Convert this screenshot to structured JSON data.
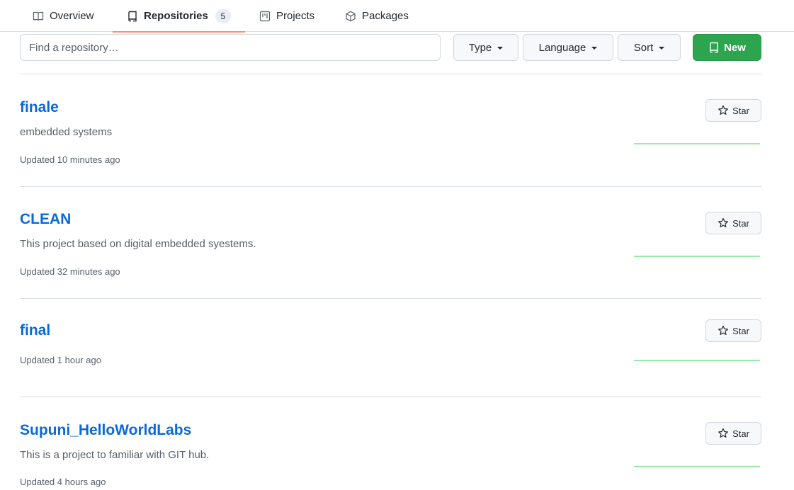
{
  "tabs": [
    {
      "label": "Overview",
      "icon": "book-icon"
    },
    {
      "label": "Repositories",
      "icon": "repo-icon",
      "count": "5"
    },
    {
      "label": "Projects",
      "icon": "project-icon"
    },
    {
      "label": "Packages",
      "icon": "package-icon"
    }
  ],
  "filters": {
    "search_placeholder": "Find a repository…",
    "type_label": "Type",
    "language_label": "Language",
    "sort_label": "Sort",
    "new_label": "New"
  },
  "repos": [
    {
      "name": "finale",
      "description": "embedded systems",
      "updated": "Updated 10 minutes ago",
      "star_label": "Star"
    },
    {
      "name": "CLEAN",
      "description": "This project based on digital embedded syestems.",
      "updated": "Updated 32 minutes ago",
      "star_label": "Star"
    },
    {
      "name": "final",
      "description": "",
      "updated": "Updated 1 hour ago",
      "star_label": "Star"
    },
    {
      "name": "Supuni_HelloWorldLabs",
      "description": "This is a project to familiar with GIT hub.",
      "updated": "Updated 4 hours ago",
      "star_label": "Star"
    }
  ],
  "colors": {
    "link": "#0969da",
    "primary_button": "#2da44e",
    "active_tab_underline": "#fd8c73",
    "activity_graph": "#9be9a8"
  }
}
